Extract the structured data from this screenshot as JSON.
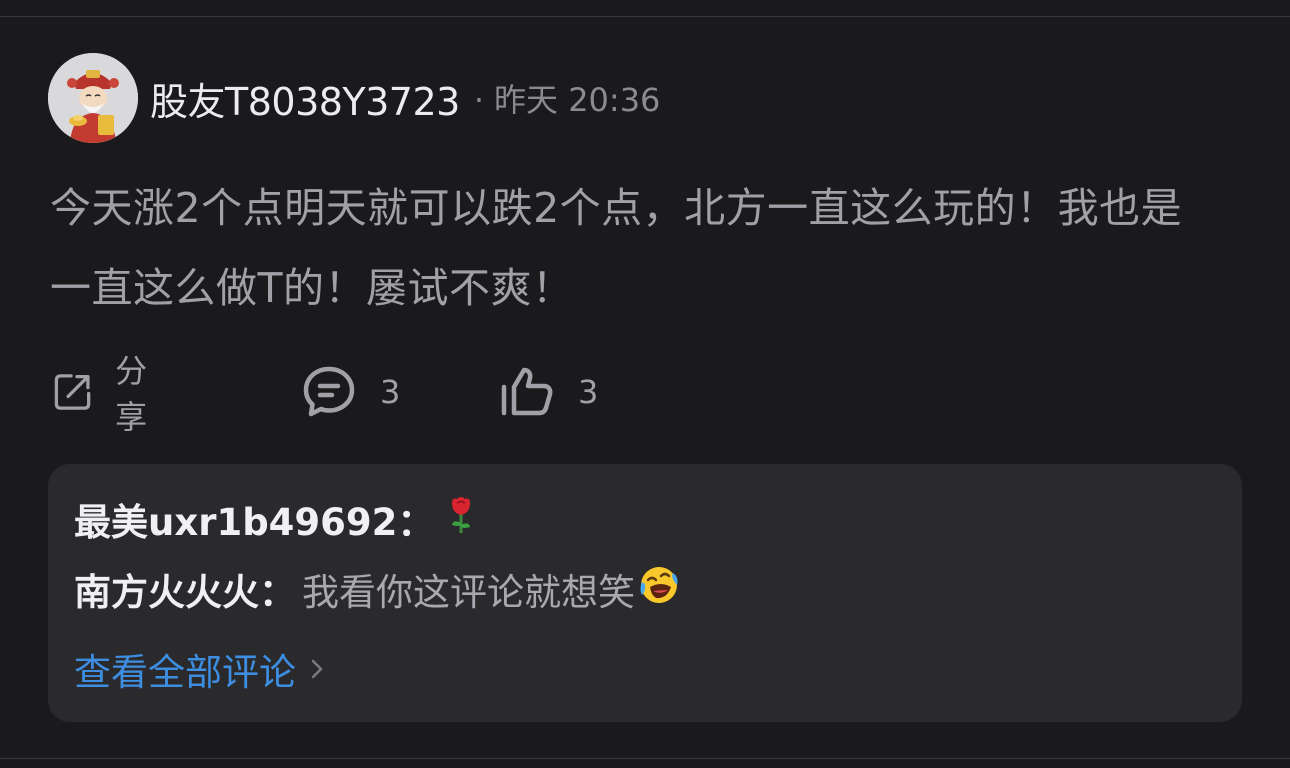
{
  "post": {
    "username": "股友T8038Y3723",
    "dot": "·",
    "time": "昨天 20:36",
    "content": "今天涨2个点明天就可以跌2个点，北方一直这么玩的！我也是一直这么做T的！屡试不爽！"
  },
  "actions": {
    "share_label": "分享",
    "comment_count": "3",
    "like_count": "3"
  },
  "comments": [
    {
      "author": "最美uxr1b49692：",
      "text": "",
      "emoji": "rose-emoji"
    },
    {
      "author": "南方火火火：",
      "text": "我看你这评论就想笑",
      "emoji": "laughing-tears-emoji"
    }
  ],
  "view_all_label": "查看全部评论",
  "colors": {
    "background": "#1a1a1c",
    "card": "#2a2a2d",
    "link": "#3d8de0",
    "muted_text": "#a0a0a6"
  }
}
